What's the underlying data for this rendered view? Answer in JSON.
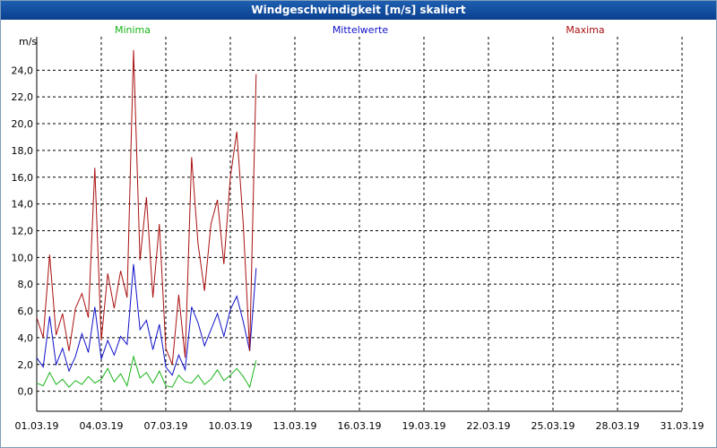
{
  "window": {
    "title": "Windgeschwindigkeit [m/s] skaliert"
  },
  "colors": {
    "minima": "#18b418",
    "mittelwerte": "#1010c8",
    "maxima": "#aa1010",
    "grid": "#000000",
    "title_bar": "#1a56a6"
  },
  "chart_data": {
    "type": "line",
    "title": "Windgeschwindigkeit [m/s] skaliert",
    "ylabel": "m/s",
    "xlabel": "",
    "ylim": [
      -1.5,
      26.5
    ],
    "xlim": [
      0,
      30
    ],
    "yticks": [
      "0,0",
      "2,0",
      "4,0",
      "6,0",
      "8,0",
      "10,0",
      "12,0",
      "14,0",
      "16,0",
      "18,0",
      "20,0",
      "22,0",
      "24,0"
    ],
    "yticks_values": [
      0,
      2,
      4,
      6,
      8,
      10,
      12,
      14,
      16,
      18,
      20,
      22,
      24
    ],
    "xticks": [
      "01.03.19",
      "04.03.19",
      "07.03.19",
      "10.03.19",
      "13.03.19",
      "16.03.19",
      "19.03.19",
      "22.03.19",
      "25.03.19",
      "28.03.19",
      "31.03.19"
    ],
    "grid": true,
    "legend_position": "top",
    "series": [
      {
        "name": "Minima",
        "color": "#18b418",
        "x": [
          0,
          0.3,
          0.6,
          0.9,
          1.2,
          1.5,
          1.8,
          2.1,
          2.4,
          2.7,
          3.0,
          3.3,
          3.6,
          3.9,
          4.2,
          4.5,
          4.8,
          5.1,
          5.4,
          5.7,
          6.0,
          6.3,
          6.6,
          6.9,
          7.2,
          7.5,
          7.8,
          8.1,
          8.4,
          8.7,
          9.0,
          9.3,
          9.6,
          9.9,
          10.2
        ],
        "y": [
          0.6,
          0.4,
          1.4,
          0.5,
          0.9,
          0.3,
          0.8,
          0.5,
          1.1,
          0.6,
          0.9,
          1.7,
          0.7,
          1.3,
          0.4,
          2.6,
          1.0,
          1.4,
          0.6,
          1.5,
          0.4,
          0.3,
          1.2,
          0.7,
          0.6,
          1.2,
          0.5,
          0.9,
          1.6,
          0.8,
          1.2,
          1.7,
          1.1,
          0.3,
          2.3
        ]
      },
      {
        "name": "Mittelwerte",
        "color": "#1010c8",
        "x": [
          0,
          0.3,
          0.6,
          0.9,
          1.2,
          1.5,
          1.8,
          2.1,
          2.4,
          2.7,
          3.0,
          3.3,
          3.6,
          3.9,
          4.2,
          4.5,
          4.8,
          5.1,
          5.4,
          5.7,
          6.0,
          6.3,
          6.6,
          6.9,
          7.2,
          7.5,
          7.8,
          8.1,
          8.4,
          8.7,
          9.0,
          9.3,
          9.6,
          9.9,
          10.2
        ],
        "y": [
          2.5,
          1.8,
          5.6,
          2.0,
          3.2,
          1.5,
          2.6,
          4.3,
          2.9,
          6.3,
          2.4,
          3.8,
          2.7,
          4.1,
          3.5,
          9.5,
          4.6,
          5.3,
          3.1,
          5.0,
          1.8,
          1.2,
          2.7,
          1.6,
          6.3,
          5.1,
          3.4,
          4.6,
          5.8,
          4.1,
          6.1,
          7.1,
          5.2,
          3.0,
          9.2
        ]
      },
      {
        "name": "Maxima",
        "color": "#aa1010",
        "x": [
          0,
          0.3,
          0.6,
          0.9,
          1.2,
          1.5,
          1.8,
          2.1,
          2.4,
          2.7,
          3.0,
          3.3,
          3.6,
          3.9,
          4.2,
          4.5,
          4.8,
          5.1,
          5.4,
          5.7,
          6.0,
          6.3,
          6.6,
          6.9,
          7.2,
          7.5,
          7.8,
          8.1,
          8.4,
          8.7,
          9.0,
          9.3,
          9.6,
          9.9,
          10.2
        ],
        "y": [
          5.5,
          4.0,
          10.2,
          4.2,
          5.8,
          3.0,
          6.2,
          7.3,
          5.5,
          16.7,
          3.8,
          8.8,
          6.2,
          9.0,
          7.0,
          25.5,
          9.8,
          14.5,
          7.0,
          12.5,
          3.2,
          2.0,
          7.2,
          2.5,
          17.5,
          11.0,
          7.5,
          12.5,
          14.3,
          9.5,
          16.0,
          19.4,
          12.5,
          3.0,
          23.7
        ]
      }
    ]
  }
}
